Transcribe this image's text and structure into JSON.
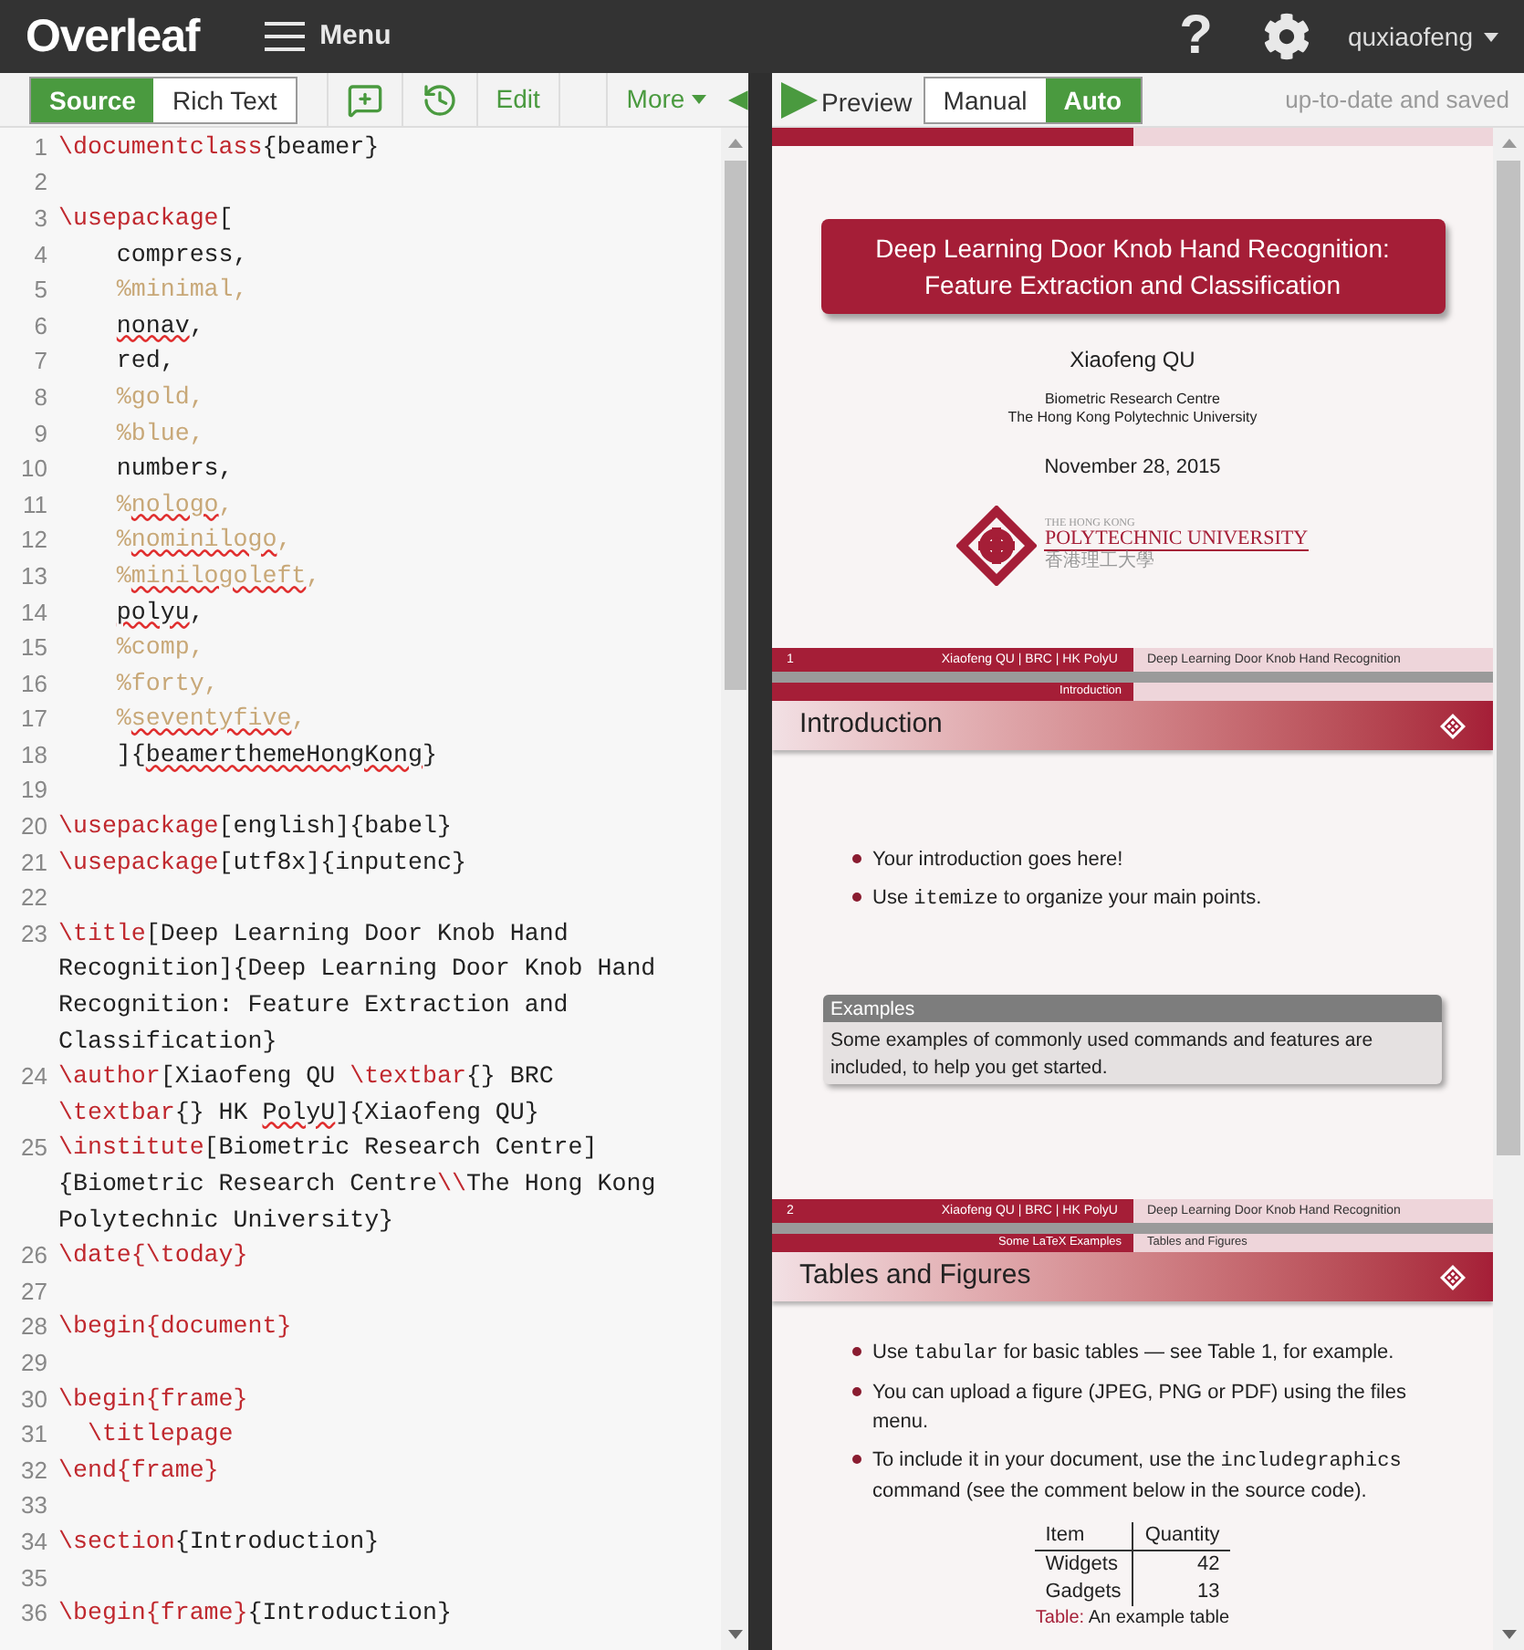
{
  "topbar": {
    "logo": "Overleaf",
    "menu": "Menu",
    "help": "?",
    "user": "quxiaofeng"
  },
  "toolbar": {
    "editor_modes": [
      {
        "label": "Source",
        "selected": true
      },
      {
        "label": "Rich Text",
        "selected": false
      }
    ],
    "edit": "Edit",
    "more": "More",
    "preview": "Preview",
    "compile_modes": [
      {
        "label": "Manual",
        "selected": false
      },
      {
        "label": "Auto",
        "selected": true
      }
    ],
    "status": "up-to-date and saved"
  },
  "editor": {
    "lines": [
      {
        "number": "1",
        "visual_lines": [
          {
            "tokens": [
              {
                "kind": "command",
                "text": "\\documentclass"
              },
              {
                "kind": "plain",
                "text": "{beamer}"
              }
            ]
          }
        ]
      },
      {
        "number": "2"
      },
      {
        "number": "3",
        "visual_lines": [
          {
            "tokens": [
              {
                "kind": "command",
                "text": "\\usepackage"
              },
              {
                "kind": "plain",
                "text": "["
              }
            ]
          }
        ]
      },
      {
        "number": "4",
        "visual_lines": [
          {
            "tokens": [
              {
                "kind": "plain",
                "text": "    compress,"
              }
            ]
          }
        ]
      },
      {
        "number": "5",
        "visual_lines": [
          {
            "tokens": [
              {
                "kind": "comment",
                "text": "    %minimal,"
              }
            ]
          }
        ]
      },
      {
        "number": "6",
        "visual_lines": [
          {
            "tokens": [
              {
                "kind": "indent"
              },
              {
                "kind": "plain_typo",
                "text": "nonav"
              },
              {
                "kind": "plain",
                "text": ","
              }
            ]
          }
        ]
      },
      {
        "number": "7",
        "visual_lines": [
          {
            "tokens": [
              {
                "kind": "plain",
                "text": "    red,"
              }
            ]
          }
        ]
      },
      {
        "number": "8",
        "visual_lines": [
          {
            "tokens": [
              {
                "kind": "comment",
                "text": "    %gold,"
              }
            ]
          }
        ]
      },
      {
        "number": "9",
        "visual_lines": [
          {
            "tokens": [
              {
                "kind": "comment",
                "text": "    %blue,"
              }
            ]
          }
        ]
      },
      {
        "number": "10",
        "visual_lines": [
          {
            "tokens": [
              {
                "kind": "plain",
                "text": "    numbers,"
              }
            ]
          }
        ]
      },
      {
        "number": "11",
        "visual_lines": [
          {
            "tokens": [
              {
                "kind": "comment",
                "text": "    %"
              },
              {
                "kind": "comment_typo",
                "text": "nologo"
              },
              {
                "kind": "comment",
                "text": ","
              }
            ]
          }
        ]
      },
      {
        "number": "12",
        "visual_lines": [
          {
            "tokens": [
              {
                "kind": "comment",
                "text": "    %"
              },
              {
                "kind": "comment_typo",
                "text": "nominilogo"
              },
              {
                "kind": "comment",
                "text": ","
              }
            ]
          }
        ]
      },
      {
        "number": "13",
        "visual_lines": [
          {
            "tokens": [
              {
                "kind": "comment",
                "text": "    %"
              },
              {
                "kind": "comment_typo",
                "text": "minilogoleft"
              },
              {
                "kind": "comment",
                "text": ","
              }
            ]
          }
        ]
      },
      {
        "number": "14",
        "visual_lines": [
          {
            "tokens": [
              {
                "kind": "indent"
              },
              {
                "kind": "plain_typo",
                "text": "polyu"
              },
              {
                "kind": "plain",
                "text": ","
              }
            ]
          }
        ]
      },
      {
        "number": "15",
        "visual_lines": [
          {
            "tokens": [
              {
                "kind": "comment",
                "text": "    %comp,"
              }
            ]
          }
        ]
      },
      {
        "number": "16",
        "visual_lines": [
          {
            "tokens": [
              {
                "kind": "comment",
                "text": "    %forty,"
              }
            ]
          }
        ]
      },
      {
        "number": "17",
        "visual_lines": [
          {
            "tokens": [
              {
                "kind": "comment",
                "text": "    %"
              },
              {
                "kind": "comment_typo",
                "text": "seventyfive"
              },
              {
                "kind": "comment",
                "text": ","
              }
            ]
          }
        ]
      },
      {
        "number": "18",
        "visual_lines": [
          {
            "tokens": [
              {
                "kind": "plain",
                "text": "    ]{"
              },
              {
                "kind": "plain_typo",
                "text": "beamerthemeHongKong"
              },
              {
                "kind": "plain",
                "text": "}"
              }
            ]
          }
        ]
      },
      {
        "number": "19"
      },
      {
        "number": "20",
        "visual_lines": [
          {
            "tokens": [
              {
                "kind": "command",
                "text": "\\usepackage"
              },
              {
                "kind": "plain",
                "text": "[english]{babel}"
              }
            ]
          }
        ]
      },
      {
        "number": "21",
        "visual_lines": [
          {
            "tokens": [
              {
                "kind": "command",
                "text": "\\usepackage"
              },
              {
                "kind": "plain",
                "text": "[utf8x]{inputenc}"
              }
            ]
          }
        ]
      },
      {
        "number": "22"
      },
      {
        "number": "23",
        "visual_lines": [
          {
            "tokens": [
              {
                "kind": "command",
                "text": "\\title"
              },
              {
                "kind": "plain",
                "text": "[Deep Learning Door Knob Hand"
              }
            ]
          },
          {
            "tokens": [
              {
                "kind": "plain",
                "text": "Recognition]{Deep Learning Door Knob Hand"
              }
            ]
          },
          {
            "tokens": [
              {
                "kind": "plain",
                "text": "Recognition: Feature Extraction and"
              }
            ]
          },
          {
            "tokens": [
              {
                "kind": "plain",
                "text": "Classification}"
              }
            ]
          }
        ]
      },
      {
        "number": "24",
        "visual_lines": [
          {
            "tokens": [
              {
                "kind": "command",
                "text": "\\author"
              },
              {
                "kind": "plain",
                "text": "[Xiaofeng QU "
              },
              {
                "kind": "command",
                "text": "\\textbar"
              },
              {
                "kind": "plain",
                "text": "{} BRC"
              }
            ]
          },
          {
            "tokens": [
              {
                "kind": "command",
                "text": "\\textbar"
              },
              {
                "kind": "plain",
                "text": "{} HK "
              },
              {
                "kind": "plain_typo",
                "text": "PolyU"
              },
              {
                "kind": "plain",
                "text": "]{Xiaofeng QU}"
              }
            ]
          }
        ]
      },
      {
        "number": "25",
        "visual_lines": [
          {
            "tokens": [
              {
                "kind": "command",
                "text": "\\institute"
              },
              {
                "kind": "plain",
                "text": "[Biometric Research Centre]"
              }
            ]
          },
          {
            "tokens": [
              {
                "kind": "plain",
                "text": "{Biometric Research Centre"
              },
              {
                "kind": "command",
                "text": "\\\\"
              },
              {
                "kind": "plain",
                "text": "The Hong Kong"
              }
            ]
          },
          {
            "tokens": [
              {
                "kind": "plain",
                "text": "Polytechnic University}"
              }
            ]
          }
        ]
      },
      {
        "number": "26",
        "visual_lines": [
          {
            "tokens": [
              {
                "kind": "command",
                "text": "\\date{\\today}"
              }
            ]
          }
        ]
      },
      {
        "number": "27"
      },
      {
        "number": "28",
        "visual_lines": [
          {
            "tokens": [
              {
                "kind": "command",
                "text": "\\begin{document}"
              }
            ]
          }
        ]
      },
      {
        "number": "29"
      },
      {
        "number": "30",
        "visual_lines": [
          {
            "tokens": [
              {
                "kind": "command",
                "text": "\\begin{frame}"
              }
            ]
          }
        ]
      },
      {
        "number": "31",
        "visual_lines": [
          {
            "tokens": [
              {
                "kind": "command",
                "text": "  \\titlepage"
              }
            ]
          }
        ]
      },
      {
        "number": "32",
        "visual_lines": [
          {
            "tokens": [
              {
                "kind": "command",
                "text": "\\end{frame}"
              }
            ]
          }
        ]
      },
      {
        "number": "33"
      },
      {
        "number": "34",
        "visual_lines": [
          {
            "tokens": [
              {
                "kind": "command",
                "text": "\\section"
              },
              {
                "kind": "plain",
                "text": "{Introduction}"
              }
            ]
          }
        ]
      },
      {
        "number": "35"
      },
      {
        "number": "36",
        "visual_lines": [
          {
            "tokens": [
              {
                "kind": "command",
                "text": "\\begin{frame}"
              },
              {
                "kind": "plain",
                "text": "{Introduction}"
              }
            ]
          }
        ]
      }
    ]
  },
  "preview": {
    "slides": [
      {
        "kind": "title_page",
        "title": "Deep Learning Door Knob Hand Recognition: Feature Extraction and Classification",
        "author": "Xiaofeng QU",
        "institute": [
          "Biometric Research Centre",
          "The Hong Kong Polytechnic University"
        ],
        "date": "November 28, 2015",
        "logo": {
          "line1": "THE HONG KONG",
          "line2": "POLYTECHNIC UNIVERSITY",
          "line3": "香港理工大學"
        },
        "footer": {
          "number": "1",
          "left": "Xiaofeng QU | BRC | HK PolyU",
          "right": "Deep Learning Door Knob Hand Recognition"
        }
      },
      {
        "kind": "content",
        "nav": {
          "section": "Introduction"
        },
        "title": "Introduction",
        "bullets": [
          [
            {
              "kind": "text",
              "text": "Your introduction goes here!"
            }
          ],
          [
            {
              "kind": "text",
              "text": "Use "
            },
            {
              "kind": "code",
              "text": "itemize"
            },
            {
              "kind": "text",
              "text": " to organize your main points."
            }
          ]
        ],
        "block": {
          "title": "Examples",
          "body": "Some examples of commonly used commands and features are included, to help you get started."
        },
        "footer": {
          "number": "2",
          "left": "Xiaofeng QU | BRC | HK PolyU",
          "right": "Deep Learning Door Knob Hand Recognition"
        }
      },
      {
        "kind": "content",
        "nav": {
          "section": "Some LaTeX Examples",
          "subsection": "Tables and Figures"
        },
        "title": "Tables and Figures",
        "bullets": [
          [
            {
              "kind": "text",
              "text": "Use "
            },
            {
              "kind": "code",
              "text": "tabular"
            },
            {
              "kind": "text",
              "text": " for basic tables — see Table 1, for example."
            }
          ],
          [
            {
              "kind": "text",
              "text": "You can upload a figure (JPEG, PNG or PDF) using the files menu."
            }
          ],
          [
            {
              "kind": "text",
              "text": "To include it in your document, use the "
            },
            {
              "kind": "code",
              "text": "includegraphics"
            },
            {
              "kind": "text",
              "text": " command (see the comment below in the source code)."
            }
          ]
        ],
        "table": {
          "columns": [
            "Item",
            "Quantity"
          ],
          "rows": [
            [
              "Widgets",
              "42"
            ],
            [
              "Gadgets",
              "13"
            ]
          ]
        },
        "caption": {
          "label": "Table:",
          "text": "An example table"
        }
      }
    ]
  }
}
